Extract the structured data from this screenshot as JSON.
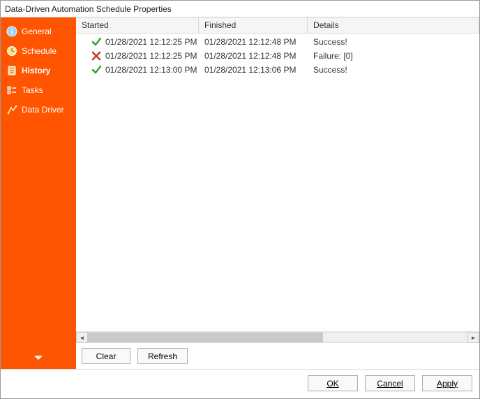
{
  "window": {
    "title": "Data-Driven Automation Schedule Properties"
  },
  "sidebar": {
    "items": [
      {
        "label": "General"
      },
      {
        "label": "Schedule"
      },
      {
        "label": "History"
      },
      {
        "label": "Tasks"
      },
      {
        "label": "Data Driver"
      }
    ]
  },
  "grid": {
    "headers": {
      "started": "Started",
      "finished": "Finished",
      "details": "Details"
    },
    "rows": [
      {
        "status": "success",
        "started": "01/28/2021 12:12:25 PM",
        "finished": "01/28/2021 12:12:48 PM",
        "details": "Success!"
      },
      {
        "status": "failure",
        "started": "01/28/2021 12:12:25 PM",
        "finished": "01/28/2021 12:12:48 PM",
        "details": "Failure: [0]"
      },
      {
        "status": "success",
        "started": "01/28/2021 12:13:00 PM",
        "finished": "01/28/2021 12:13:06 PM",
        "details": "Success!"
      }
    ]
  },
  "toolbar": {
    "clear": "Clear",
    "refresh": "Refresh"
  },
  "footer": {
    "ok": "OK",
    "cancel": "Cancel",
    "apply": "Apply"
  }
}
